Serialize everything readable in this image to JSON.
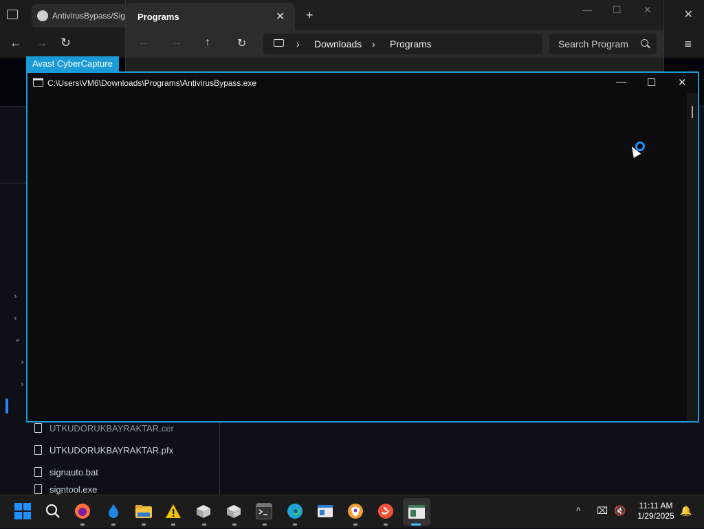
{
  "browser": {
    "tab_title": "AntivirusBypass/Sig",
    "close_glyph": "✕",
    "nav_glyphs": {
      "back": "←",
      "forward": "→",
      "reload": "↻",
      "menu": "≡"
    }
  },
  "github": {
    "chevrons": [
      "›",
      "›",
      "⌄",
      "›",
      "›"
    ],
    "files": [
      {
        "name": "UTKUDORUKBAYRAKTAR.cer"
      },
      {
        "name": "UTKUDORUKBAYRAKTAR.pfx"
      },
      {
        "name": "signauto.bat"
      },
      {
        "name": "signtool.exe"
      }
    ]
  },
  "explorer": {
    "tab_title": "Programs",
    "tab_close": "✕",
    "new_tab": "+",
    "window_controls": {
      "minimize": "—",
      "maximize": "☐",
      "close": "✕"
    },
    "nav": {
      "back": "←",
      "forward": "→",
      "up": "↑",
      "refresh": "↻"
    },
    "breadcrumbs": [
      "Downloads",
      "Programs"
    ],
    "separator": "›",
    "search_placeholder": "Search Program"
  },
  "avast": {
    "label": "Avast CyberCapture"
  },
  "console": {
    "title": "C:\\Users\\VM6\\Downloads\\Programs\\AntivirusBypass.exe",
    "controls": {
      "minimize": "—",
      "maximize": "☐",
      "close": "✕"
    }
  },
  "taskbar": {
    "icons": [
      {
        "name": "start-icon"
      },
      {
        "name": "search-icon"
      },
      {
        "name": "firefox-icon",
        "color": "#ff7139"
      },
      {
        "name": "water-drop-icon",
        "color": "#1e88e5"
      },
      {
        "name": "file-explorer-icon",
        "color": "#f5c542"
      },
      {
        "name": "warning-icon",
        "color": "#f2c300"
      },
      {
        "name": "package-icon",
        "color": "#d0d0d0"
      },
      {
        "name": "package-icon-2",
        "color": "#d0d0d0"
      },
      {
        "name": "terminal-icon",
        "color": "#333333"
      },
      {
        "name": "edge-icon",
        "color": "#1fa5d6"
      },
      {
        "name": "app-window-icon",
        "color": "#2f7dd1"
      },
      {
        "name": "shield-browser-icon",
        "color": "#f0a030"
      },
      {
        "name": "swift-icon",
        "color": "#f05138"
      },
      {
        "name": "console-app-icon",
        "color": "#3c7a5a"
      }
    ],
    "tray": {
      "chevron": "^",
      "network": "⌧",
      "volume": "🔇",
      "notification": "🔔"
    },
    "time": "11:11 AM",
    "date": "1/29/2025"
  }
}
